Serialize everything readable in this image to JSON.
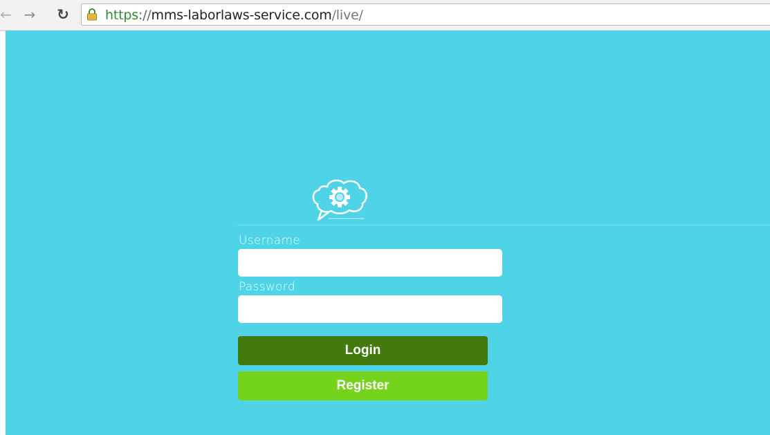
{
  "browser": {
    "url": {
      "scheme": "https",
      "separator": "://",
      "host": "mms-laborlaws-service.com",
      "path": "/live/"
    },
    "icons": {
      "back": "back-arrow-icon",
      "forward": "forward-arrow-icon",
      "reload": "reload-icon",
      "secure": "lock-icon"
    }
  },
  "login_form": {
    "username_label": "Username",
    "username_value": "",
    "password_label": "Password",
    "password_value": "",
    "login_button": "Login",
    "register_button": "Register"
  },
  "colors": {
    "page_background": "#4ed4e6",
    "login_button": "#437a0e",
    "register_button": "#74d41b",
    "secure_url": "#2f8f2f"
  }
}
